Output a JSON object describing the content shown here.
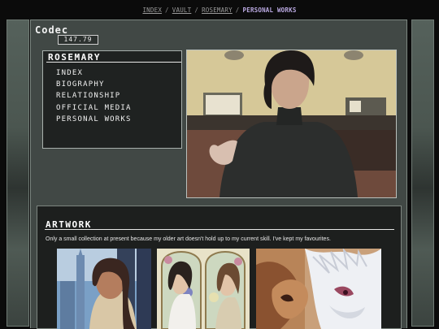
{
  "breadcrumb": {
    "items": [
      "INDEX",
      "VAULT",
      "ROSEMARY"
    ],
    "separator": "/",
    "current": "PERSONAL WORKS"
  },
  "codec": {
    "title": "Codec",
    "frequency": "147.79"
  },
  "nav": {
    "title": "ROSEMARY",
    "items": [
      "INDEX",
      "BIOGRAPHY",
      "RELATIONSHIP",
      "OFFICIAL MEDIA",
      "PERSONAL WORKS"
    ]
  },
  "portrait": {
    "icon": "character-portrait"
  },
  "artwork": {
    "title": "ARTWORK",
    "description": "Only a small collection at present because my older art doesn't hold up to my current skill. I've kept my favourites.",
    "thumbnails": [
      "city-portrait-thumbnail",
      "flower-window-thumbnail",
      "fantasy-creatures-thumbnail"
    ]
  },
  "colors": {
    "accent": "#b9a8e0",
    "frame": "#414845",
    "panel": "#1f2221"
  }
}
